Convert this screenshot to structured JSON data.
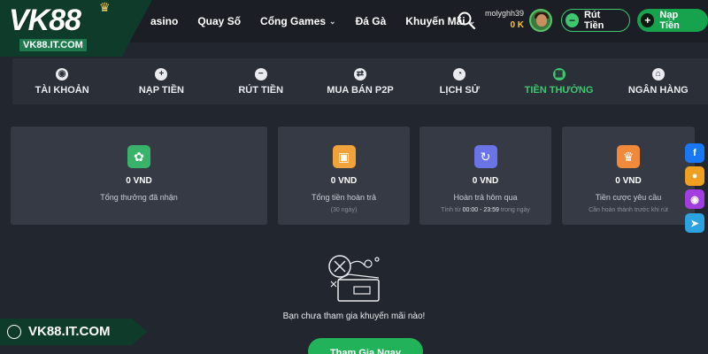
{
  "brand": {
    "logo": "VK88",
    "url": "VK88.IT.COM"
  },
  "nav": [
    {
      "label": "asino",
      "has_menu": false
    },
    {
      "label": "Quay Số",
      "has_menu": false
    },
    {
      "label": "Cổng Games",
      "has_menu": true
    },
    {
      "label": "Đá Gà",
      "has_menu": false
    },
    {
      "label": "Khuyến Mãi",
      "has_menu": true
    }
  ],
  "user": {
    "name": "molyghh39",
    "balance": "0 K"
  },
  "actions": {
    "withdraw": "Rút Tiền",
    "deposit": "Nạp Tiền"
  },
  "tabs": [
    {
      "label": "TÀI KHOẢN",
      "icon": "account-icon",
      "glyph": "◉"
    },
    {
      "label": "NẠP TIỀN",
      "icon": "plus-circle-icon",
      "glyph": "+"
    },
    {
      "label": "RÚT TIỀN",
      "icon": "minus-circle-icon",
      "glyph": "−"
    },
    {
      "label": "MUA BÁN P2P",
      "icon": "swap-icon",
      "glyph": "⇄"
    },
    {
      "label": "LỊCH SỬ",
      "icon": "clock-icon",
      "glyph": "◔"
    },
    {
      "label": "TIỀN THƯỞNG",
      "icon": "gift-icon",
      "glyph": "▦",
      "active": true
    },
    {
      "label": "NGÂN HÀNG",
      "icon": "bank-icon",
      "glyph": "⌂"
    }
  ],
  "cards": [
    {
      "amount": "0 VND",
      "label": "Tổng thưởng đã nhận",
      "icon": "reward-bag-icon",
      "color": "#3ab36a"
    },
    {
      "amount": "0 VND",
      "label": "Tổng tiền hoàn trả",
      "sub": "(30 ngày)",
      "icon": "gift-box-icon",
      "color": "#f0a33a"
    },
    {
      "amount": "0 VND",
      "label": "Hoàn trả hôm qua",
      "sub_pre": "Tính từ",
      "sub_time": "00:00 - 23:59",
      "sub_post": "trong ngày",
      "icon": "refund-icon",
      "color": "#6b74e6"
    },
    {
      "amount": "0 VND",
      "label": "Tiền cược yêu cầu",
      "sub": "Cần hoàn thành trước khi rút",
      "icon": "crown-icon",
      "color": "#f08a3a"
    }
  ],
  "empty": {
    "message": "Bạn chưa tham gia khuyến mãi nào!",
    "button": "Tham Gia Ngay"
  },
  "social": [
    {
      "icon": "facebook-icon",
      "glyph": "f",
      "color": "#1877f2"
    },
    {
      "icon": "group-icon",
      "glyph": "●",
      "color": "#f0a020"
    },
    {
      "icon": "messenger-icon",
      "glyph": "◉",
      "color": "#a23ee0"
    },
    {
      "icon": "telegram-icon",
      "glyph": "➤",
      "color": "#2aa3e0"
    }
  ],
  "watermark": "VK88.IT.COM"
}
